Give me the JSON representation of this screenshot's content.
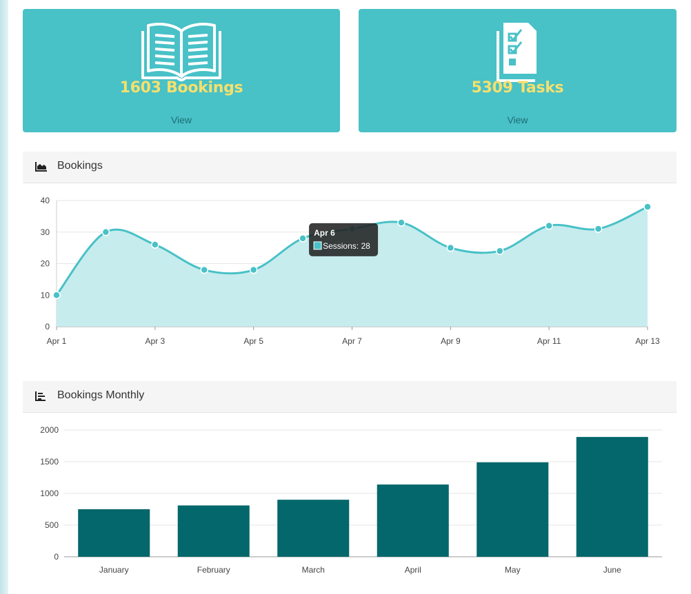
{
  "cards": [
    {
      "count": "1603 Bookings",
      "link": "View",
      "icon": "open-book-icon"
    },
    {
      "count": "5309 Tasks",
      "link": "View",
      "icon": "checklist-icon"
    }
  ],
  "panels": {
    "bookings_title": "Bookings",
    "bookings_icon": "area-chart-icon",
    "monthly_title": "Bookings Monthly",
    "monthly_icon": "bar-chart-icon"
  },
  "colors": {
    "card_bg": "#48c1c7",
    "card_count": "#f4e06e",
    "line": "#48c1c7",
    "area": "#c7ecee",
    "bar": "#03676b"
  },
  "chart_data": [
    {
      "type": "area",
      "x": [
        "Apr 1",
        "Apr 2",
        "Apr 3",
        "Apr 4",
        "Apr 5",
        "Apr 6",
        "Apr 7",
        "Apr 8",
        "Apr 9",
        "Apr 10",
        "Apr 11",
        "Apr 12",
        "Apr 13"
      ],
      "x_tick_labels": [
        "Apr 1",
        "Apr 3",
        "Apr 5",
        "Apr 7",
        "Apr 9",
        "Apr 11",
        "Apr 13"
      ],
      "series": [
        {
          "name": "Sessions",
          "values": [
            10,
            30,
            26,
            18,
            18,
            28,
            31,
            33,
            25,
            24,
            32,
            31,
            38
          ]
        }
      ],
      "ylim": [
        0,
        40
      ],
      "yticks": [
        0,
        10,
        20,
        30,
        40
      ],
      "grid": true,
      "tooltip": {
        "title": "Apr 6",
        "label": "Sessions: 28"
      }
    },
    {
      "type": "bar",
      "categories": [
        "January",
        "February",
        "March",
        "April",
        "May",
        "June"
      ],
      "values": [
        750,
        810,
        900,
        1140,
        1490,
        1890
      ],
      "ylim": [
        0,
        2000
      ],
      "yticks": [
        0,
        500,
        1000,
        1500,
        2000
      ],
      "grid": true
    }
  ]
}
